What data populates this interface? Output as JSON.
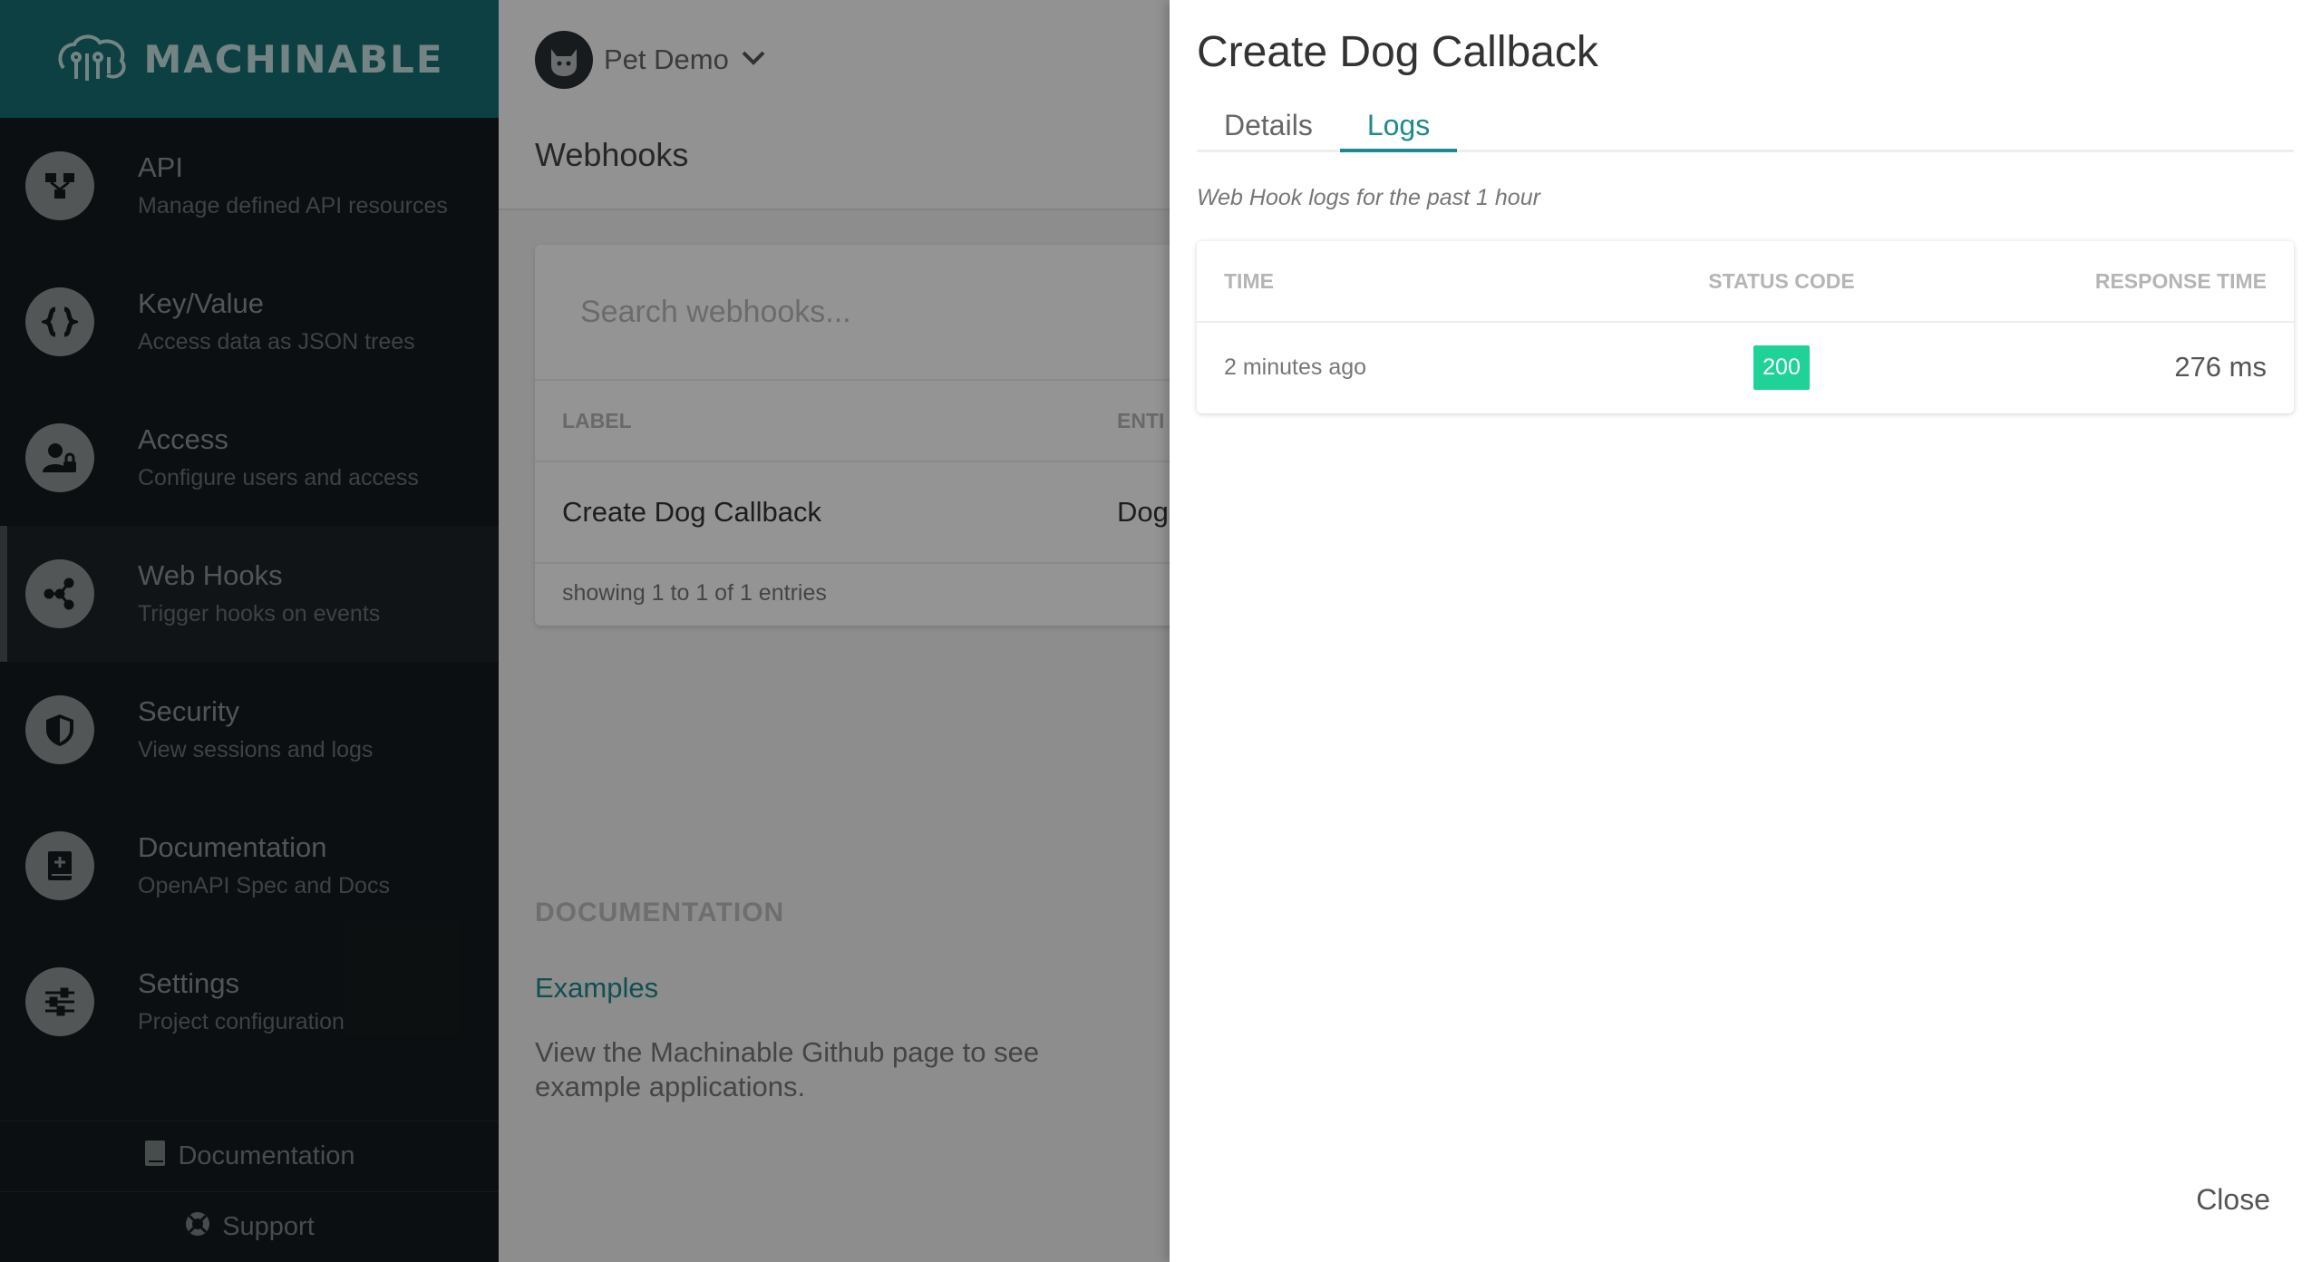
{
  "brand": {
    "name": "MACHINABLE"
  },
  "sidebar": {
    "items": [
      {
        "title": "API",
        "desc": "Manage defined API resources",
        "icon": "api-icon"
      },
      {
        "title": "Key/Value",
        "desc": "Access data as JSON trees",
        "icon": "braces-icon"
      },
      {
        "title": "Access",
        "desc": "Configure users and access",
        "icon": "user-lock-icon"
      },
      {
        "title": "Web Hooks",
        "desc": "Trigger hooks on events",
        "icon": "webhook-icon"
      },
      {
        "title": "Security",
        "desc": "View sessions and logs",
        "icon": "shield-icon"
      },
      {
        "title": "Documentation",
        "desc": "OpenAPI Spec and Docs",
        "icon": "book-icon"
      },
      {
        "title": "Settings",
        "desc": "Project configuration",
        "icon": "sliders-icon"
      }
    ],
    "footer": {
      "documentation": "Documentation",
      "support": "Support"
    }
  },
  "main": {
    "project_name": "Pet Demo",
    "page_title": "Webhooks",
    "search_placeholder": "Search webhooks...",
    "columns": {
      "label": "LABEL",
      "entity": "ENTI"
    },
    "rows": [
      {
        "label": "Create Dog Callback",
        "entity": "Dogs"
      }
    ],
    "entries_text": "showing 1 to 1 of 1 entries",
    "doc_heading": "DOCUMENTATION",
    "doc_link": "Examples",
    "doc_text": "View the Machinable Github page to see example applications."
  },
  "drawer": {
    "title": "Create Dog Callback",
    "tabs": [
      "Details",
      "Logs"
    ],
    "active_tab": "Logs",
    "note": "Web Hook logs for the past 1 hour",
    "columns": {
      "time": "TIME",
      "status": "STATUS CODE",
      "response": "RESPONSE TIME"
    },
    "logs": [
      {
        "time": "2 minutes ago",
        "status": "200",
        "response": "276 ms"
      }
    ],
    "close_label": "Close"
  },
  "colors": {
    "accent": "#1c8a8e",
    "brand_bar": "#166e72",
    "success_badge": "#1fd297",
    "sidebar_bg": "#151b1e"
  }
}
